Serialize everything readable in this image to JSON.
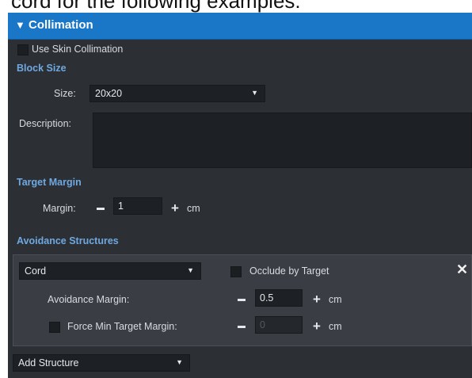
{
  "page": {
    "top_clip_text": "cord for the following examples:"
  },
  "collimation": {
    "header_title": "Collimation",
    "use_skin_label": "Use Skin Collimation",
    "block_size_title": "Block Size",
    "size_label": "Size:",
    "size_value": "20x20",
    "description_label": "Description:",
    "description_value": "",
    "target_margin_title": "Target Margin",
    "margin_label": "Margin:",
    "margin_value": "1",
    "margin_unit": "cm",
    "avoidance_title": "Avoidance Structures",
    "structure": {
      "name": "Cord",
      "occlude_label": "Occlude by Target",
      "avoid_margin_label": "Avoidance Margin:",
      "avoid_margin_value": "0.5",
      "avoid_margin_unit": "cm",
      "force_min_label": "Force Min Target Margin:",
      "force_min_value": "0",
      "force_min_unit": "cm"
    },
    "add_structure_label": "Add Structure"
  }
}
